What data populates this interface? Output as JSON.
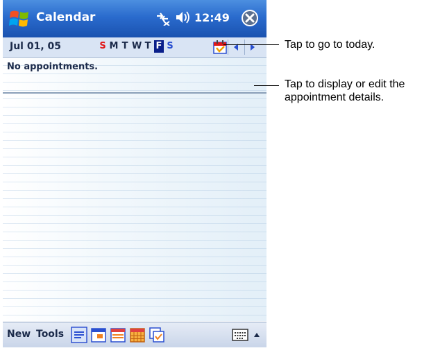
{
  "window": {
    "title": "Calendar",
    "time": "12:49"
  },
  "date_bar": {
    "date": "Jul 01, 05",
    "days": [
      "S",
      "M",
      "T",
      "W",
      "T",
      "F",
      "S"
    ],
    "selected_day_index": 5
  },
  "content": {
    "empty_message": "No appointments."
  },
  "menu": {
    "new_label": "New",
    "tools_label": "Tools"
  },
  "callouts": {
    "today": "Tap to go to today.",
    "details_line1": "Tap to display or edit the",
    "details_line2": "appointment details."
  },
  "icons": {
    "start": "windows-flag-icon",
    "connectivity": "connectivity-icon",
    "volume": "speaker-icon",
    "close": "close-icon",
    "today": "today-calendar-icon",
    "prev": "left-arrow-icon",
    "next": "right-arrow-icon",
    "views": [
      "agenda-view-icon",
      "day-view-icon",
      "week-view-icon",
      "month-view-icon",
      "year-view-icon"
    ],
    "keyboard": "keyboard-icon",
    "sip_menu": "up-arrow-icon"
  },
  "colors": {
    "titlebar": "#2a6bcd",
    "selected_day": "#0a1f8a",
    "weekend_sunday": "#e01818",
    "weekend_saturday": "#2a4fd0"
  }
}
